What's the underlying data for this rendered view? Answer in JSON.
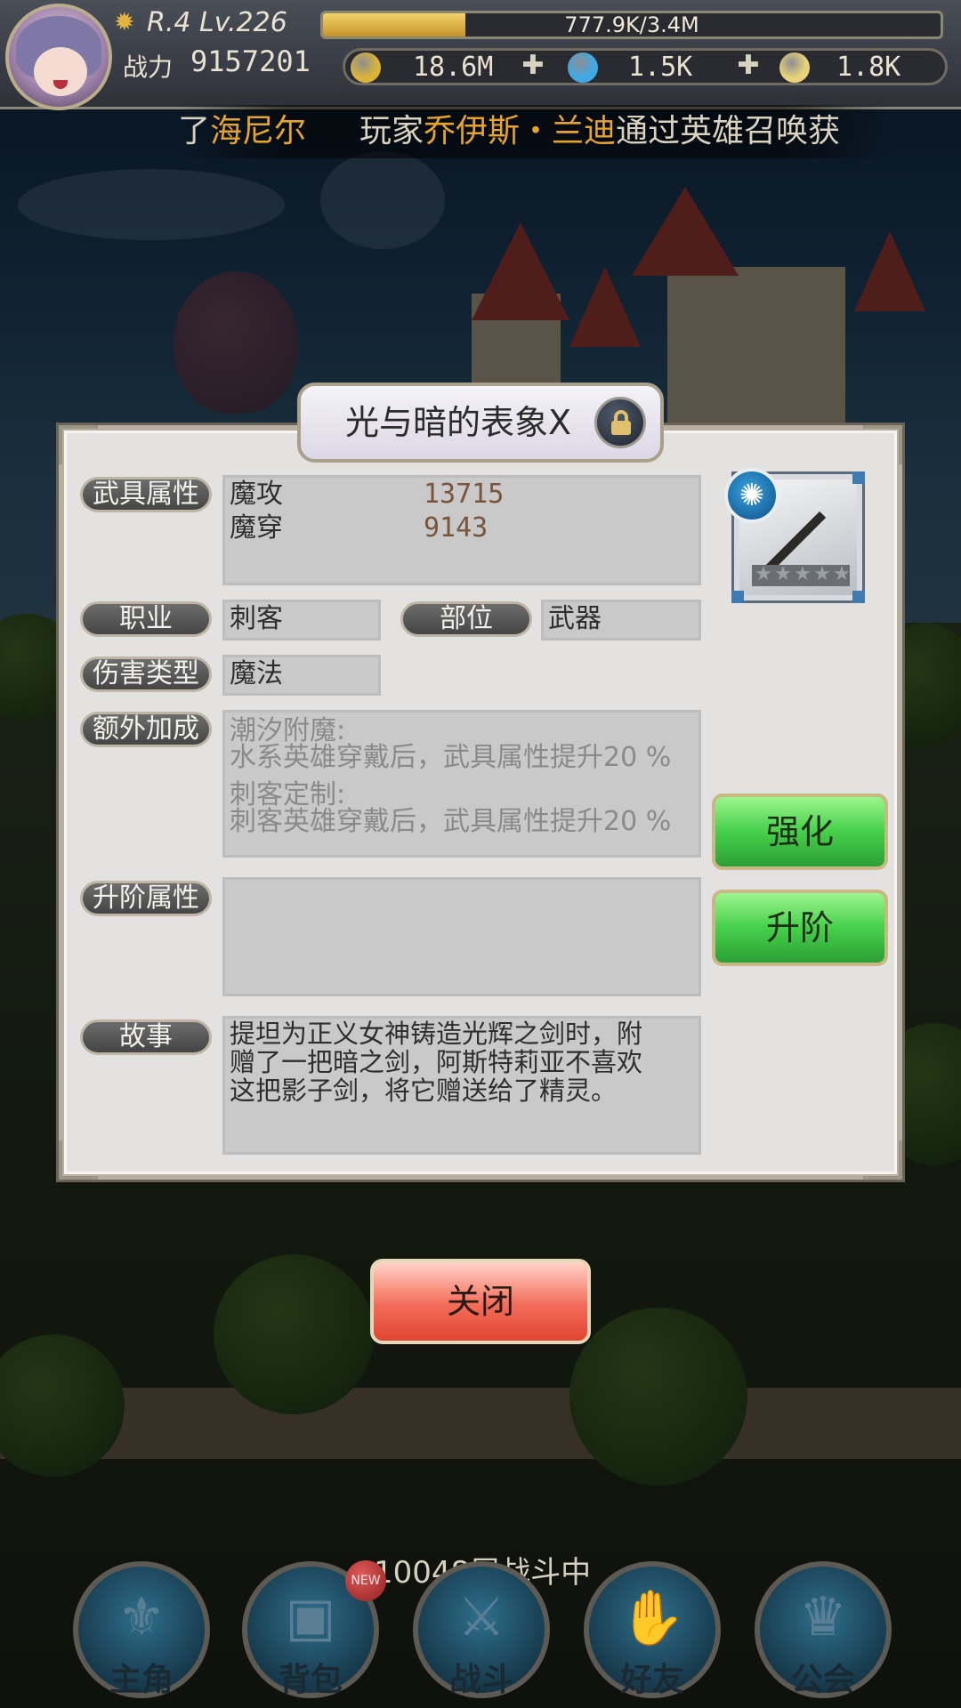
{
  "player": {
    "rank_level": "R.4 Lv.226",
    "exp_text": "777.9K/3.4M",
    "exp_fraction": 0.23,
    "power_label": "战力",
    "power_value": "9157201"
  },
  "resources": [
    {
      "icon": "gold-coin-icon",
      "value": "18.6M",
      "color": "#d9b43a"
    },
    {
      "icon": "blue-crystal-icon",
      "value": "1.5K",
      "color": "#3fa9e6"
    },
    {
      "icon": "yellow-crystal-icon",
      "value": "1.8K",
      "color": "#e8d27a"
    }
  ],
  "broadcast": {
    "part1": "了",
    "part2": "海尼尔",
    "part3": "玩家",
    "part4": "乔伊斯・兰迪",
    "part5": "通过英雄召唤获"
  },
  "modal": {
    "title": "光与暗的表象Ⅹ",
    "stats_label": "武具属性",
    "stats": [
      {
        "name": "魔攻",
        "value": "13715"
      },
      {
        "name": "魔穿",
        "value": "9143"
      }
    ],
    "class_label": "职业",
    "class_value": "刺客",
    "slot_label": "部位",
    "slot_value": "武器",
    "damage_label": "伤害类型",
    "damage_value": "魔法",
    "bonus_label": "额外加成",
    "bonus": [
      {
        "title": "潮汐附魔:",
        "desc": "水系英雄穿戴后，武具属性提升20 %"
      },
      {
        "title": "刺客定制:",
        "desc": "刺客英雄穿戴后，武具属性提升20 %"
      }
    ],
    "advance_label": "升阶属性",
    "advance_value": "",
    "story_label": "故事",
    "story_lines": [
      "提坦为正义女神铸造光辉之剑时，附",
      "赠了一把暗之剑，阿斯特莉亚不喜欢",
      "这把影子剑，将它赠送给了精灵。"
    ],
    "enhance_button": "强化",
    "advance_button": "升阶",
    "close_button": "关闭"
  },
  "bottom": {
    "floor_status": "10048层战斗中",
    "new_badge": "NEW",
    "nav": [
      {
        "label": "主角",
        "icon": "hero-icon"
      },
      {
        "label": "背包",
        "icon": "backpack-icon"
      },
      {
        "label": "战斗",
        "icon": "crossed-swords-icon"
      },
      {
        "label": "好友",
        "icon": "handshake-icon"
      },
      {
        "label": "公会",
        "icon": "guild-crest-icon"
      }
    ]
  }
}
